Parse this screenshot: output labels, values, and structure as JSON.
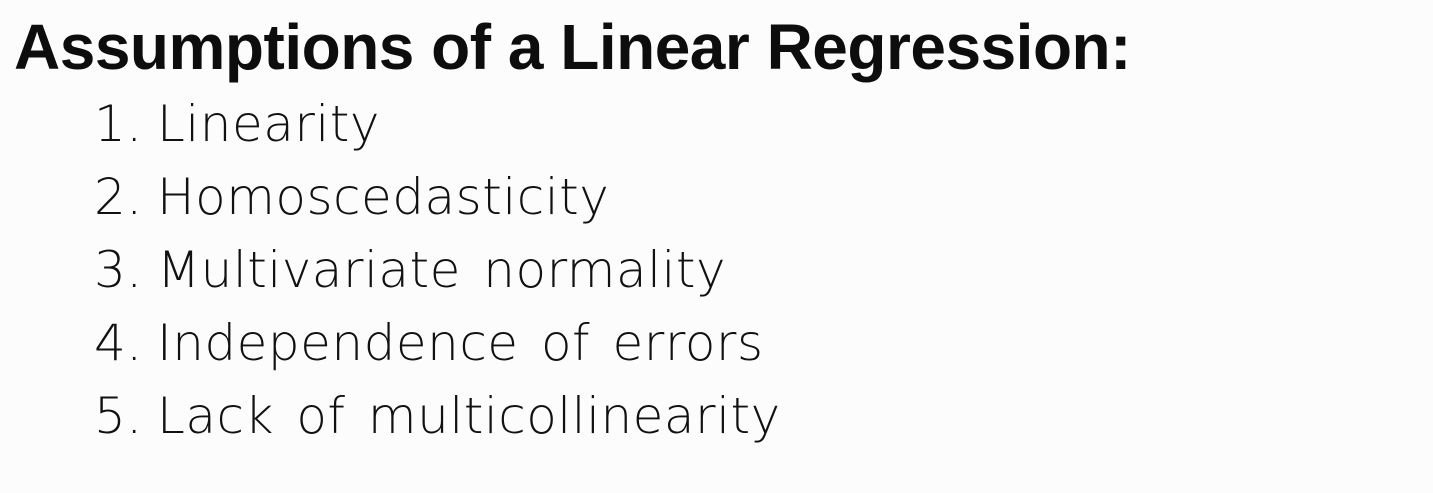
{
  "slide": {
    "title": "Assumptions of a Linear Regression:",
    "items": [
      {
        "number": "1.",
        "text": "Linearity"
      },
      {
        "number": "2.",
        "text": "Homoscedasticity"
      },
      {
        "number": "3.",
        "text": "Multivariate normality"
      },
      {
        "number": "4.",
        "text": "Independence of errors"
      },
      {
        "number": "5.",
        "text": "Lack of multicollinearity"
      }
    ]
  }
}
